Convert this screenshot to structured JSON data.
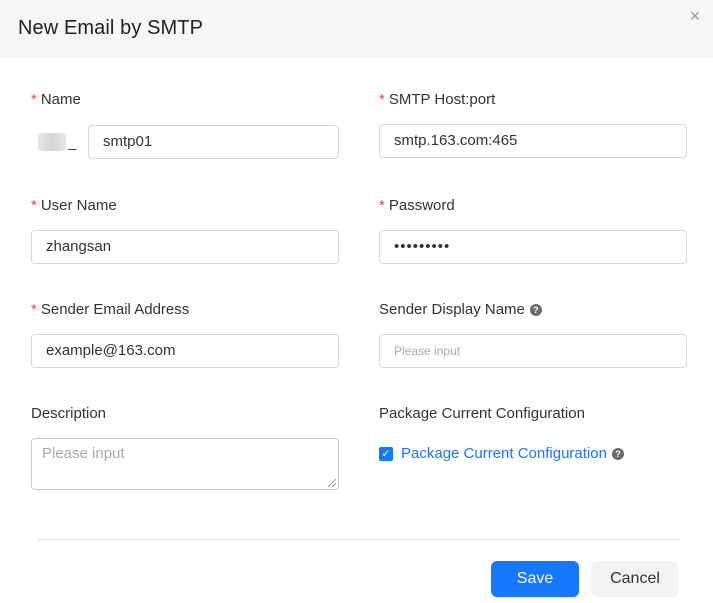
{
  "dialog": {
    "title": "New Email by SMTP",
    "close_icon": "×"
  },
  "form": {
    "name": {
      "label": "Name",
      "prefix": "_",
      "value": "smtp01"
    },
    "smtp_host": {
      "label": "SMTP Host:port",
      "value": "smtp.163.com:465"
    },
    "user_name": {
      "label": "User Name",
      "value": "zhangsan"
    },
    "password": {
      "label": "Password",
      "value": "•••••••••"
    },
    "sender_email": {
      "label": "Sender Email Address",
      "value": "example@163.com"
    },
    "sender_display": {
      "label": "Sender Display Name",
      "placeholder": "Please input"
    },
    "description": {
      "label": "Description",
      "placeholder": "Please input"
    },
    "package": {
      "label": "Package Current Configuration",
      "checkbox_label": "Package Current Configuration",
      "checked": true
    }
  },
  "footer": {
    "save_label": "Save",
    "cancel_label": "Cancel"
  },
  "colors": {
    "primary": "#1677ff",
    "required": "#e5484d",
    "header_bg": "#f5f6f8"
  },
  "icons": [
    "close-icon",
    "help-icon",
    "checkbox-checked-icon"
  ]
}
